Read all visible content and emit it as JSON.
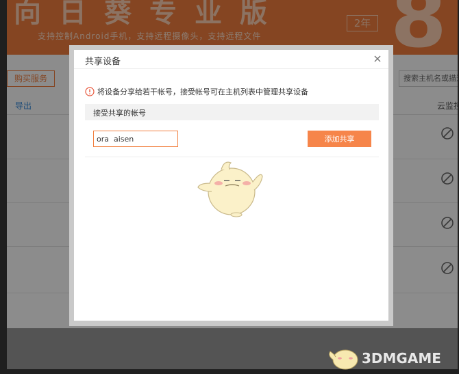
{
  "banner": {
    "title": "向日葵专业版",
    "subtitle": "支持控制Android手机，支持远程摄像头，支持远程文件",
    "badge": "2年",
    "big_number": "8"
  },
  "toolbar": {
    "buy_label": "购买服务",
    "search_placeholder": "搜索主机名或描述"
  },
  "table": {
    "export_label": "导出",
    "cloud_column": "云监控"
  },
  "dialog": {
    "title": "共享设备",
    "notice": "将设备分享给若干帐号，接受帐号可在主机列表中管理共享设备",
    "panel_label": "接受共享的帐号",
    "account_value": "ora  aisen",
    "add_button": "添加共享"
  },
  "icons": {
    "close": "close-icon",
    "notice": "warning-circle-icon",
    "row": "cloud-monitor-icon",
    "mascot": "mascot-illustration"
  },
  "watermark": {
    "text": "3DMGAME"
  },
  "colors": {
    "brand_orange": "#f27f3e",
    "button_orange": "#f6854a",
    "link_blue": "#2e86d9"
  }
}
